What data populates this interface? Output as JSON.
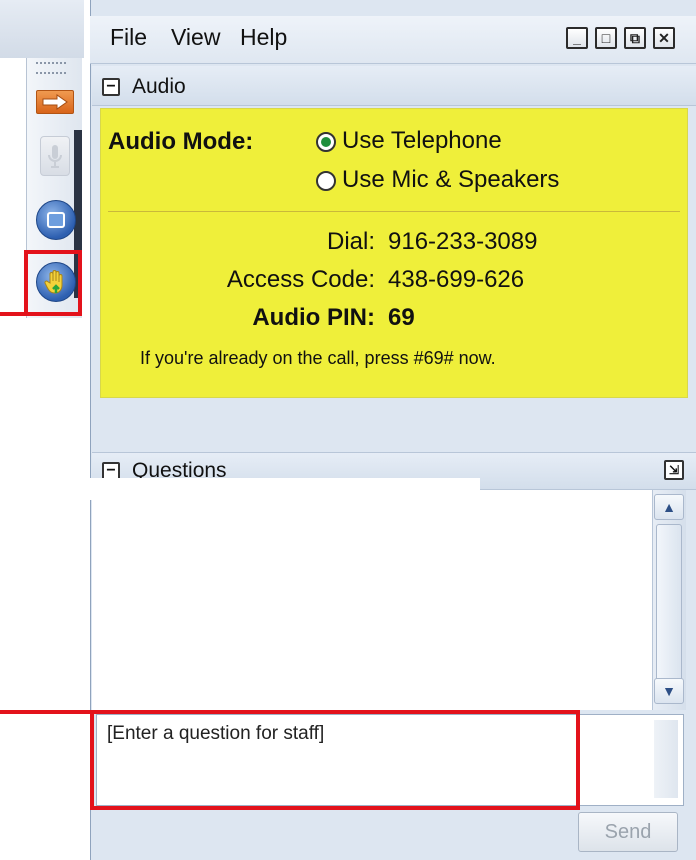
{
  "menu": {
    "file": "File",
    "view": "View",
    "help": "Help"
  },
  "window_buttons": {
    "minimize": "_",
    "maximize": "□",
    "popout": "⧉",
    "close": "✕"
  },
  "audio": {
    "title": "Audio",
    "collapse": "−",
    "mode_label": "Audio Mode:",
    "options": [
      {
        "label": "Use Telephone",
        "selected": true
      },
      {
        "label": "Use Mic & Speakers",
        "selected": false
      }
    ],
    "dial_label": "Dial:",
    "dial_value": "916-233-3089",
    "access_label": "Access Code:",
    "access_value": "438-699-626",
    "pin_label": "Audio PIN:",
    "pin_value": "69",
    "note": "If you're already on the call, press #69# now."
  },
  "questions": {
    "title": "Questions",
    "collapse": "−",
    "popout": "⇲",
    "placeholder": "[Enter a question for staff]",
    "send_label": "Send"
  },
  "colors": {
    "highlight": "#e3121b",
    "audio_panel": "#efef3a",
    "selected_radio": "#1f8e3c"
  },
  "icons": [
    "arrow-icon",
    "microphone-icon",
    "screen-icon",
    "raise-hand-icon"
  ]
}
